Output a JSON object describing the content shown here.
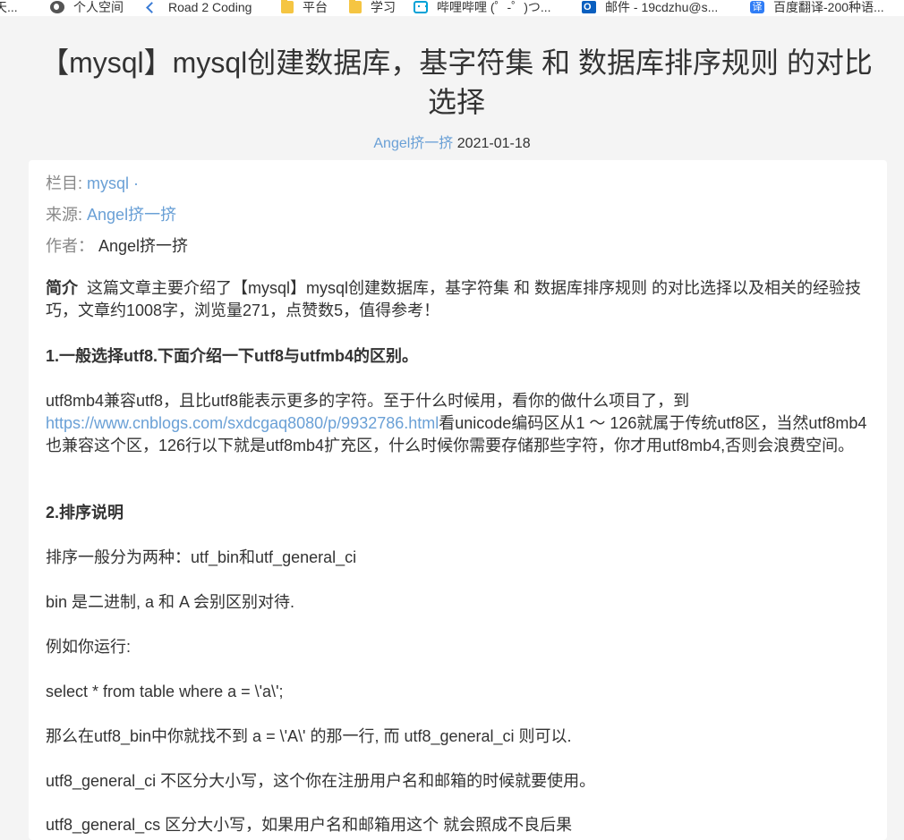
{
  "bookmarks": [
    {
      "icon": "none",
      "label": "天..."
    },
    {
      "icon": "globe-icon",
      "label": "个人空间"
    },
    {
      "icon": "code-icon",
      "label": "Road 2 Coding"
    },
    {
      "icon": "folder-icon",
      "label": "平台"
    },
    {
      "icon": "folder-icon",
      "label": "学习"
    },
    {
      "icon": "bilibili-icon",
      "label": "哔哩哔哩 (゜-゜)つ..."
    },
    {
      "icon": "outlook-icon",
      "label": "邮件 - 19cdzhu@s..."
    },
    {
      "icon": "translate-icon",
      "label": "百度翻译-200种语..."
    }
  ],
  "translate_glyph": "译",
  "article": {
    "title": "【mysql】mysql创建数据库，基字符集 和 数据库排序规则 的对比选择",
    "author_link": "Angel挤一挤",
    "date": "2021-01-18",
    "column_label": "栏目:",
    "column_value": "mysql ·",
    "source_label": "来源:",
    "source_value": "Angel挤一挤",
    "author_label": "作者：",
    "author_value": "Angel挤一挤",
    "intro_label": "简介",
    "intro_text": "这篇文章主要介绍了【mysql】mysql创建数据库，基字符集 和 数据库排序规则 的对比选择以及相关的经验技巧，文章约1008字，浏览量271，点赞数5，值得参考！",
    "h1": "1.一般选择utf8.下面介绍一下utf8与utfmb4的区别。",
    "p1_a": "utf8mb4兼容utf8，且比utf8能表示更多的字符。至于什么时候用，看你的做什么项目了，到",
    "p1_link": "https://www.cnblogs.com/sxdcgaq8080/p/9932786.html",
    "p1_b": "看unicode编码区从1 ～ 126就属于传统utf8区，当然utf8mb4也兼容这个区，126行以下就是utf8mb4扩充区，什么时候你需要存储那些字符，你才用utf8mb4,否则会浪费空间。",
    "h2": "2.排序说明",
    "p2": "排序一般分为两种：utf_bin和utf_general_ci",
    "p3": "bin 是二进制, a 和 A 会别区别对待.",
    "p4": "例如你运行:",
    "p5": "select * from table where a = \\'a\\';",
    "p6": "那么在utf8_bin中你就找不到 a = \\'A\\' 的那一行, 而 utf8_general_ci 则可以.",
    "p7": "utf8_general_ci 不区分大小写，这个你在注册用户名和邮箱的时候就要使用。",
    "p8": "utf8_general_cs 区分大小写，如果用户名和邮箱用这个 就会照成不良后果"
  }
}
